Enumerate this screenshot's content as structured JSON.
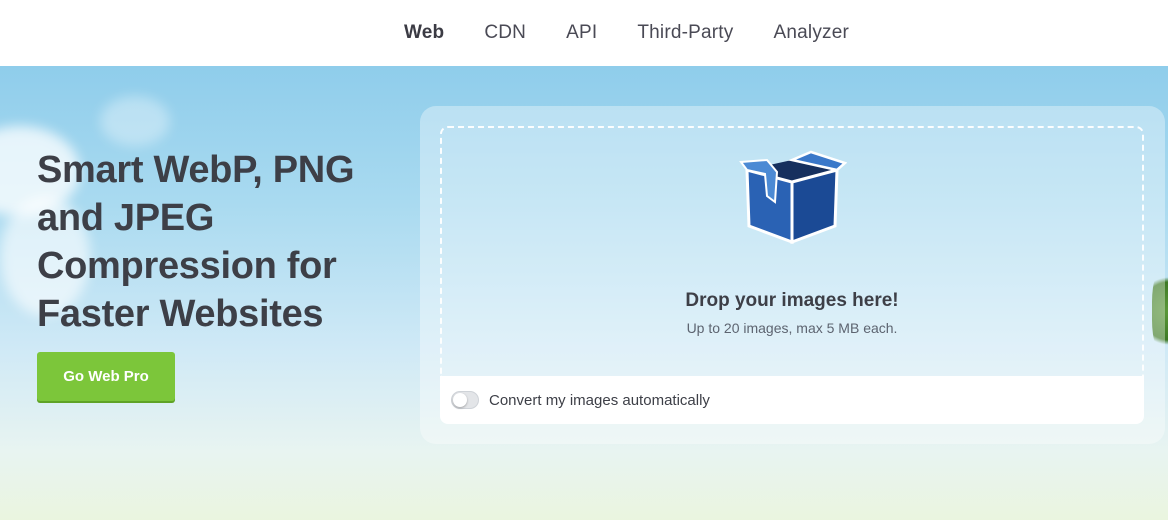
{
  "nav": {
    "items": [
      {
        "label": "Web",
        "active": true
      },
      {
        "label": "CDN",
        "active": false
      },
      {
        "label": "API",
        "active": false
      },
      {
        "label": "Third-Party",
        "active": false
      },
      {
        "label": "Analyzer",
        "active": false
      }
    ]
  },
  "hero": {
    "headline_lines": [
      "Smart WebP, PNG",
      "and JPEG",
      "Compression for",
      "Faster Websites"
    ],
    "cta_label": "Go Web Pro"
  },
  "upload": {
    "icon": "box-icon",
    "title": "Drop your images here!",
    "subtitle": "Up to 20 images, max 5 MB each.",
    "toggle_label": "Convert my images automatically",
    "toggle_on": false
  },
  "colors": {
    "accent_green": "#7cc63a",
    "text_dark": "#3d3f47",
    "sky_top": "#8fcdeb",
    "box_blue": "#1f5aa8"
  }
}
